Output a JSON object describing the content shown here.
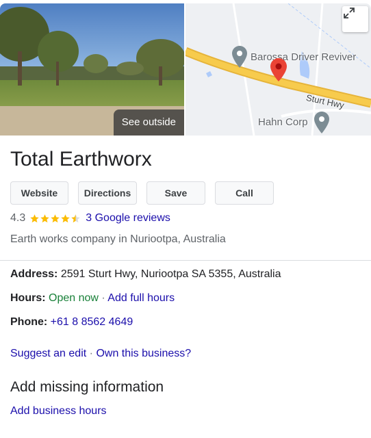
{
  "media": {
    "see_outside_label": "See outside"
  },
  "map": {
    "labels": {
      "barossa": "Barossa Driver Reviver",
      "highway": "Sturt Hwy",
      "hahn": "Hahn Corp"
    },
    "colors": {
      "highway": "#f7cb4d",
      "pin": "#ea4335",
      "poi": "#7c8c94",
      "water": "#aecbfa"
    }
  },
  "business": {
    "name": "Total Earthworx",
    "actions": {
      "website": "Website",
      "directions": "Directions",
      "save": "Save",
      "call": "Call"
    },
    "rating": {
      "value": "4.3",
      "stars": 4.3,
      "reviews_link": "3 Google reviews"
    },
    "category": "Earth works company in Nuriootpa, Australia"
  },
  "details": {
    "address_label": "Address:",
    "address_value": "2591 Sturt Hwy, Nuriootpa SA 5355, Australia",
    "hours_label": "Hours:",
    "hours_status": "Open now",
    "separator": "·",
    "add_full_hours": "Add full hours",
    "phone_label": "Phone:",
    "phone_value": "+61 8 8562 4649"
  },
  "edit_links": {
    "suggest_edit": "Suggest an edit",
    "separator": "·",
    "own_business": "Own this business?"
  },
  "missing": {
    "title": "Add missing information",
    "add_hours": "Add business hours"
  },
  "colors": {
    "link": "#1a0dab",
    "open": "#188038",
    "star": "#fbbc04"
  }
}
